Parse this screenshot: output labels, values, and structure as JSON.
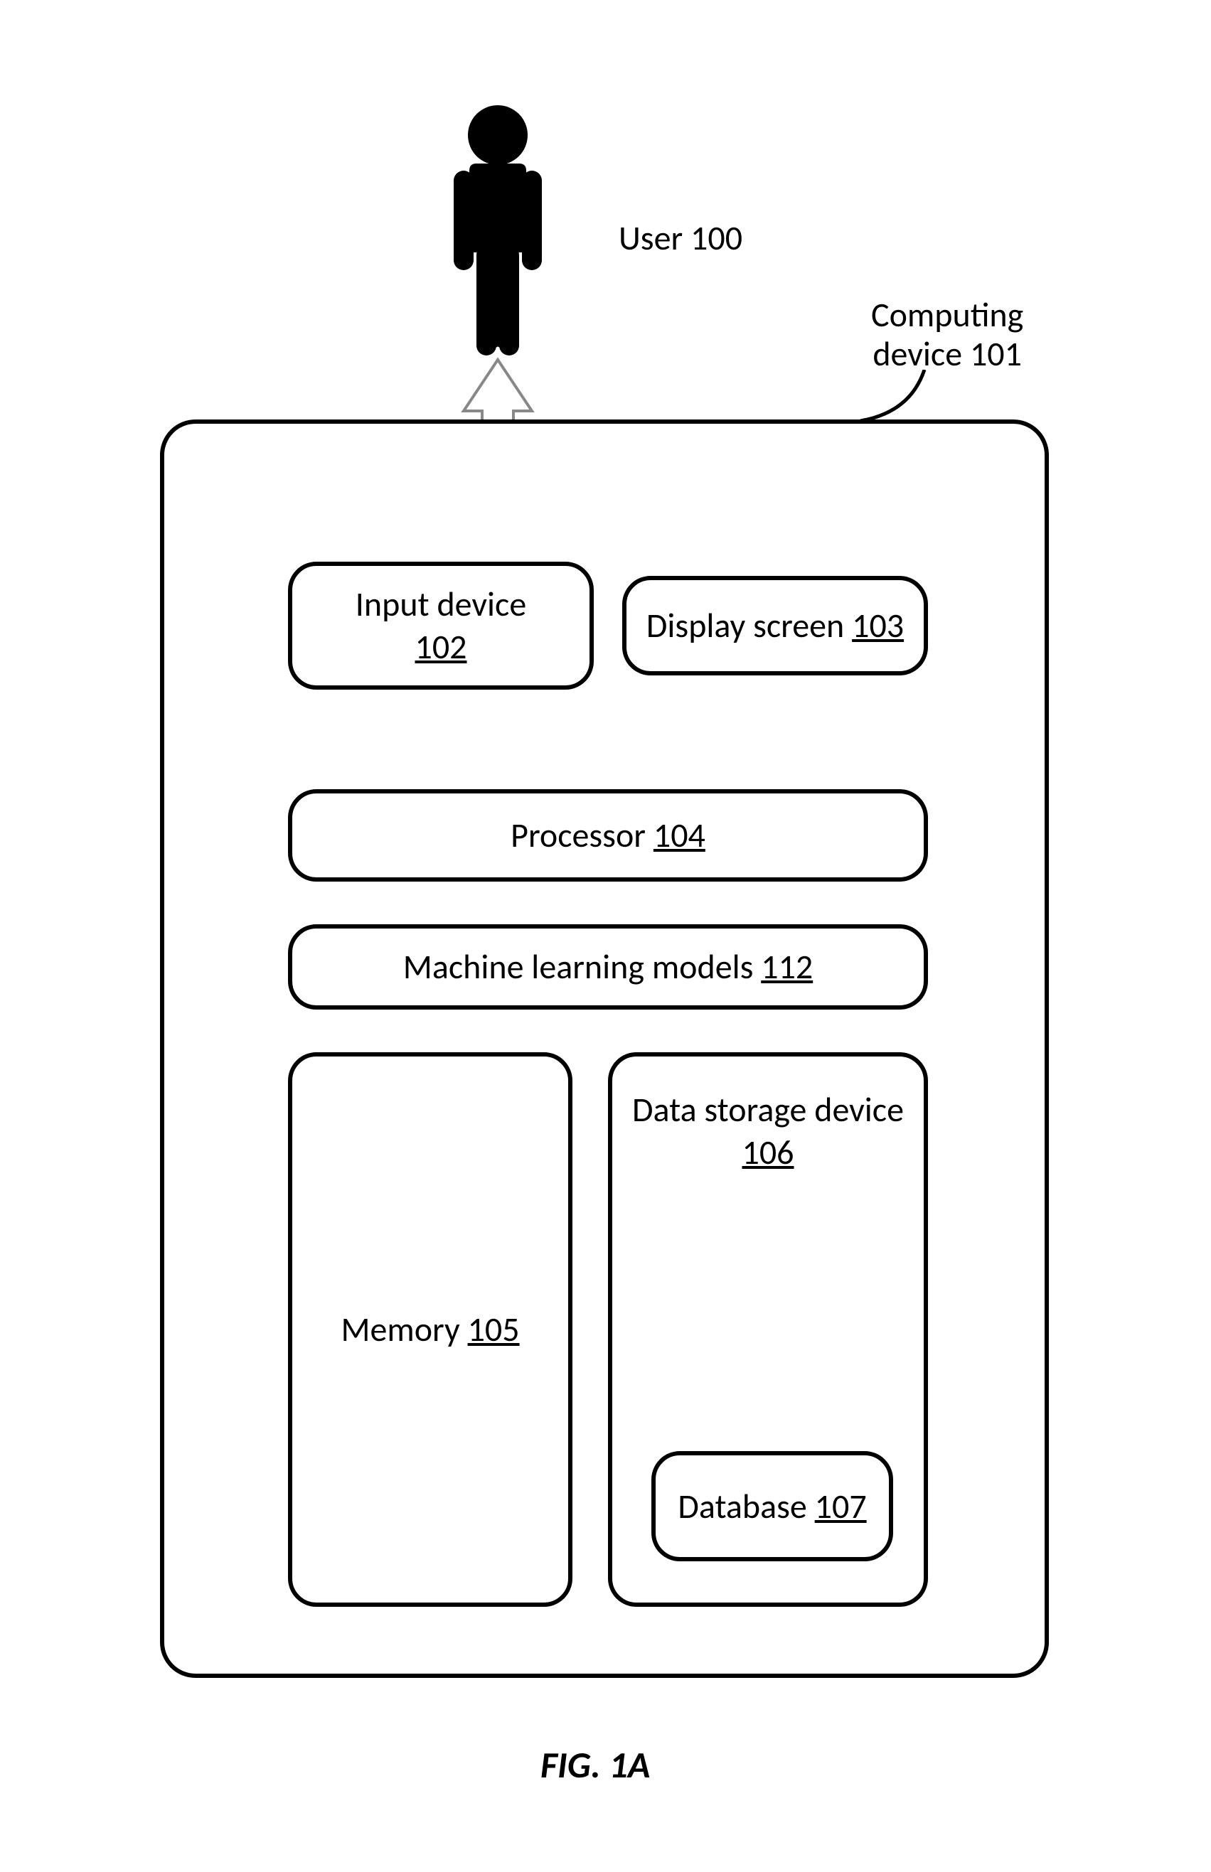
{
  "user": {
    "label": "User",
    "ref": "100"
  },
  "computing_device": {
    "label": "Computing",
    "label2": "device",
    "ref": "101"
  },
  "boxes": {
    "input_device": {
      "label": "Input device",
      "ref": "102"
    },
    "display_screen": {
      "label": "Display screen",
      "ref": "103"
    },
    "processor": {
      "label": "Processor",
      "ref": "104"
    },
    "ml_models": {
      "label": "Machine learning models",
      "ref": "112"
    },
    "memory": {
      "label": "Memory",
      "ref": "105"
    },
    "storage": {
      "label": "Data storage device",
      "ref": "106"
    },
    "database": {
      "label": "Database",
      "ref": "107"
    }
  },
  "figure_caption": "FIG. 1A"
}
